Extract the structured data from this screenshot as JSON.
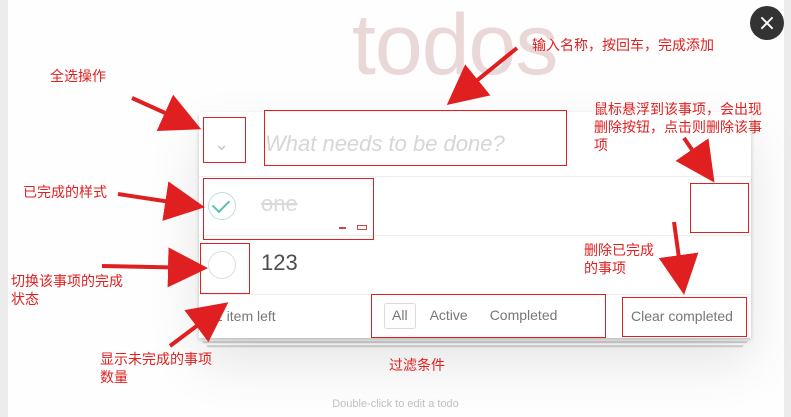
{
  "app": {
    "title": "todos",
    "close_icon": "×",
    "new_todo_placeholder": "What needs to be done?",
    "toggle_all_icon": "⌄"
  },
  "todos": [
    {
      "title": "one",
      "completed": true
    },
    {
      "title": "123",
      "completed": false
    }
  ],
  "footer": {
    "count_text": "1 item left",
    "filters": [
      "All",
      "Active",
      "Completed"
    ],
    "selected_filter": "All",
    "clear_label": "Clear completed"
  },
  "info": {
    "text": "Double-click to edit a todo"
  },
  "annotations": {
    "select_all": "全选操作",
    "input_hint": "输入名称，按回车，完成添加",
    "hover_delete": [
      "鼠标悬浮到该事项，会出现",
      "删除按钮，点击则删除该事",
      "项"
    ],
    "completed_style": "已完成的样式",
    "toggle_state": [
      "切换该事项的完成",
      "状态"
    ],
    "clear_completed": [
      "删除已完成",
      "的事项"
    ],
    "items_left": [
      "显示未完成的事项",
      "数量"
    ],
    "filter_conditions": "过滤条件"
  },
  "colors": {
    "annotation": "#e02020",
    "check_done": "#5dc2af",
    "title": "#ead7d7"
  }
}
